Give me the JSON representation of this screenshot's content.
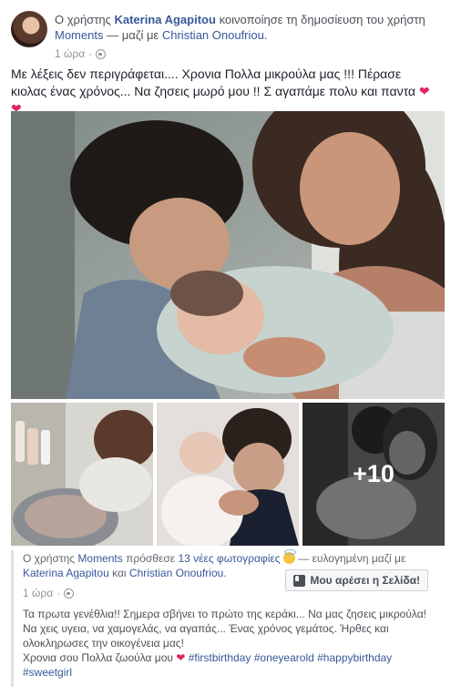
{
  "header": {
    "prefix": "Ο χρήστης",
    "author": "Katerina Agapitou",
    "shared_text": "κοινοποίησε τη δημοσίευση του χρήστη",
    "source": "Moments",
    "with_text": "— μαζί με",
    "tagged": "Christian Onoufriou.",
    "time": "1 ώρα"
  },
  "post": {
    "text": "Με λέξεις δεν περιγράφεται.... Χρονια Πολλα μικρούλα μας !!! Πέρασε κιολας ένας χρόνος... Να ζησεις μωρό μου !! Σ αγαπάμε πολυ και παντα",
    "hearts": "❤❤"
  },
  "photos": {
    "more_count": "+10"
  },
  "shared_post": {
    "prefix": "Ο χρήστης",
    "page": "Moments",
    "action": "πρόσθεσε",
    "photos_link": "13 νέες φωτογραφίες",
    "feeling": "— ευλογημένη μαζί με",
    "person1": "Katerina Agapitou",
    "and": "και",
    "person2": "Christian Onoufriou.",
    "time": "1 ώρα",
    "like_page_button": "Μου αρέσει η Σελίδα!",
    "body_line1": "Τα πρωτα γενέθλια!! Σημερα σβήνει το πρώτο της κεράκι... Να μας ζησεις μικρούλα! Να χεις υγεια, να χαμογελάς, να αγαπάς... Ένας χρόνος γεμάτος. Ήρθες και ολοκληρωσες την οικογένεια μας!",
    "body_line2": "Χρονια σου Πολλα ζωούλα μου",
    "heart": "❤",
    "hashtags": "#firstbirthday #oneyearold #happybirthday #sweetgirl"
  },
  "colors": {
    "link": "#365899",
    "text": "#1d2129",
    "meta": "#90949c",
    "heart": "#e0245e"
  }
}
